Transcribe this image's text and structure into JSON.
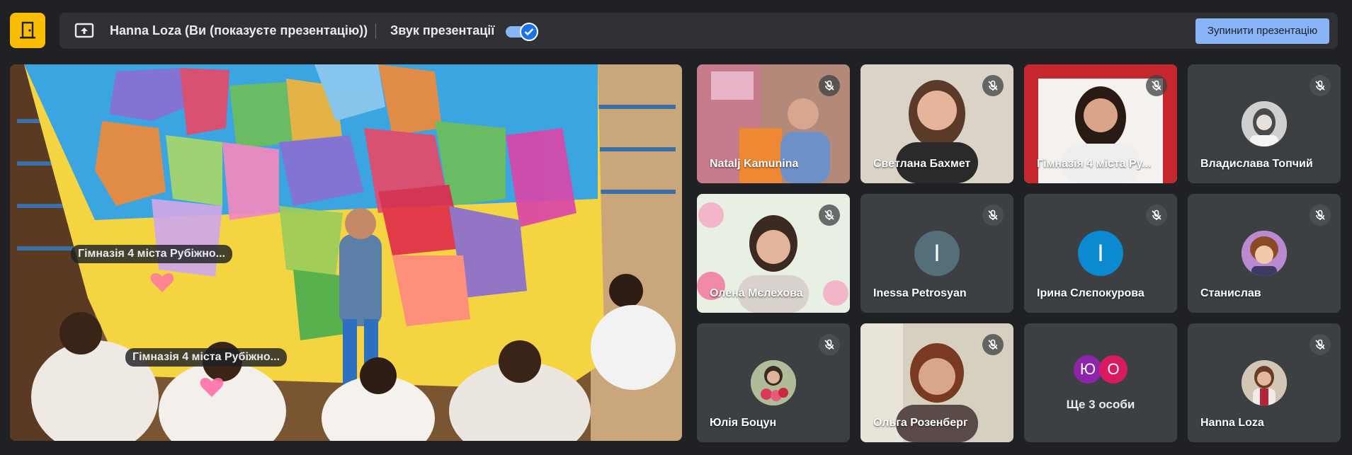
{
  "topbar": {
    "app_icon": "door-exit-icon",
    "present_icon": "present-screen-icon",
    "presenter_label": "Hanna Loza (Ви (показуєте презентацію))",
    "sound_label": "Звук презентації",
    "sound_enabled": true,
    "stop_button_label": "Зупинити презентацію"
  },
  "main": {
    "chips": [
      "Гімназія 4 міста Рубіжно...",
      "Гімназія 4 міста Рубіжно..."
    ]
  },
  "participants": [
    {
      "name": "Natalj Kamunina",
      "muted": true,
      "kind": "video"
    },
    {
      "name": "Светлана Бахмет",
      "muted": true,
      "kind": "video"
    },
    {
      "name": "Гімназія 4 міста Ру...",
      "muted": true,
      "kind": "video"
    },
    {
      "name": "Владислава Топчий",
      "muted": true,
      "kind": "avatar-photo"
    },
    {
      "name": "Олена Мєлехова",
      "muted": true,
      "kind": "video"
    },
    {
      "name": "Inessa Petrosyan",
      "muted": true,
      "kind": "initial",
      "initial": "I",
      "color": "#546e7a"
    },
    {
      "name": "Ірина Слєпокурова",
      "muted": true,
      "kind": "initial",
      "initial": "І",
      "color": "#0b89d1"
    },
    {
      "name": "Станислав",
      "muted": true,
      "kind": "avatar-photo"
    },
    {
      "name": "Юлія Боцун",
      "muted": true,
      "kind": "avatar-photo"
    },
    {
      "name": "Ольга Розенберг",
      "muted": true,
      "kind": "video"
    },
    {
      "name": "Ще 3 особи",
      "muted": false,
      "kind": "more",
      "initials": [
        "Ю",
        "О"
      ],
      "colors": [
        "#8e24aa",
        "#d81b60"
      ]
    },
    {
      "name": "Hanna Loza",
      "muted": true,
      "kind": "avatar-photo"
    }
  ],
  "colors": {
    "background": "#202124",
    "surface": "#303134",
    "tile": "#3c4043",
    "accent": "#8ab4f8",
    "app_icon": "#fbbc04"
  }
}
